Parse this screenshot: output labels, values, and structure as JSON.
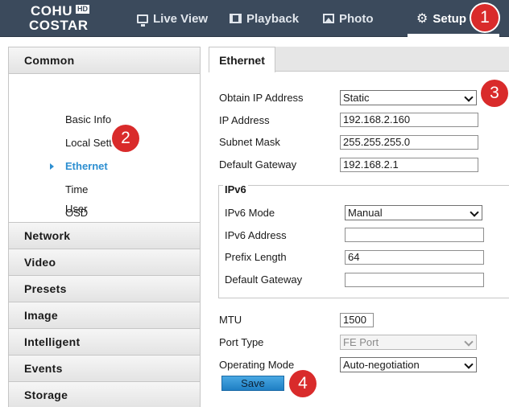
{
  "brand": {
    "line1": "COHU",
    "hd": "HD",
    "line2": "COSTAR"
  },
  "nav": [
    {
      "label": "Live View",
      "icon": "monitor-icon"
    },
    {
      "label": "Playback",
      "icon": "film-icon"
    },
    {
      "label": "Photo",
      "icon": "photo-icon"
    },
    {
      "label": "Setup",
      "icon": "gear-icon"
    }
  ],
  "badges": [
    "1",
    "2",
    "3",
    "4"
  ],
  "sidebar": {
    "common": "Common",
    "sub": [
      "Basic Info",
      "Local Settings",
      "Ethernet",
      "Time",
      "OSD",
      "User"
    ],
    "active_sub": "Ethernet",
    "categories": [
      "Network",
      "Video",
      "Presets",
      "Image",
      "Intelligent",
      "Events",
      "Storage"
    ]
  },
  "tab": "Ethernet",
  "form": {
    "obtain_ip_label": "Obtain IP Address",
    "obtain_ip_value": "Static",
    "ip_label": "IP Address",
    "ip_value": "192.168.2.160",
    "mask_label": "Subnet Mask",
    "mask_value": "255.255.255.0",
    "gateway_label": "Default Gateway",
    "gateway_value": "192.168.2.1",
    "ipv6_title": "IPv6",
    "ipv6_mode_label": "IPv6 Mode",
    "ipv6_mode_value": "Manual",
    "ipv6_addr_label": "IPv6 Address",
    "ipv6_addr_value": "",
    "prefix_label": "Prefix Length",
    "prefix_value": "64",
    "ipv6_gateway_label": "Default Gateway",
    "ipv6_gateway_value": "",
    "mtu_label": "MTU",
    "mtu_value": "1500",
    "port_type_label": "Port Type",
    "port_type_value": "FE Port",
    "op_mode_label": "Operating Mode",
    "op_mode_value": "Auto-negotiation",
    "save_label": "Save"
  },
  "colors": {
    "topbar": "#3b4a5c",
    "accent": "#2e8fd1",
    "badge": "#d92b2b",
    "save": "#2a8fd4"
  }
}
